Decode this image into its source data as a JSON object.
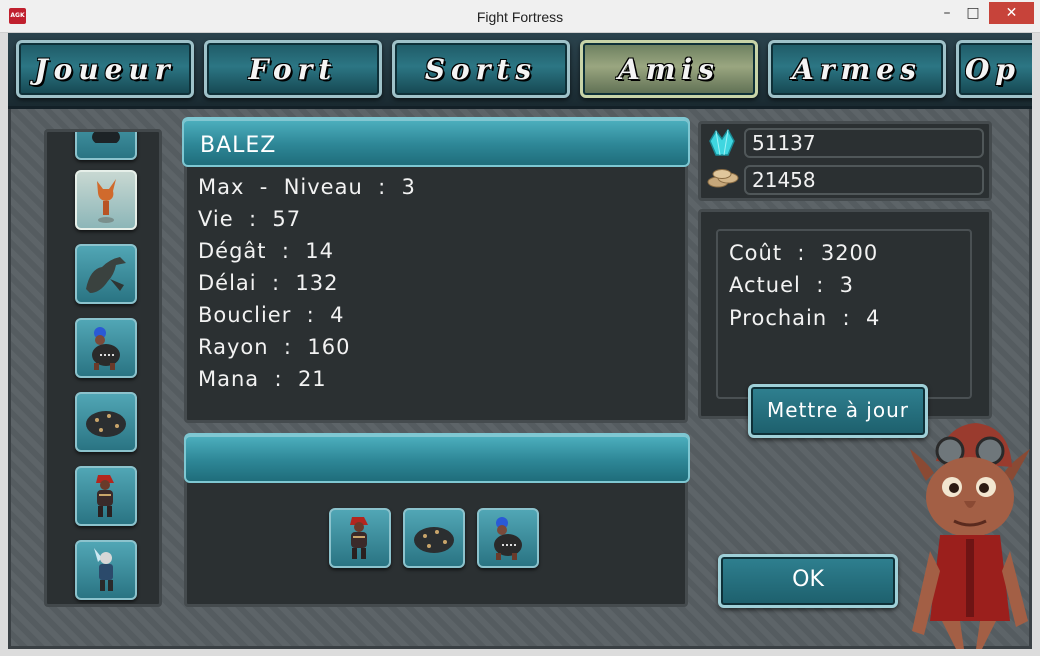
{
  "window": {
    "icon_text": "AGK",
    "title": "Fight Fortress",
    "minimize": "–",
    "maximize": "□",
    "close": "✕"
  },
  "tabs": [
    {
      "label": "Joueur",
      "active": false
    },
    {
      "label": "Fort",
      "active": false
    },
    {
      "label": "Sorts",
      "active": false
    },
    {
      "label": "Amis",
      "active": true
    },
    {
      "label": "Armes",
      "active": false
    },
    {
      "label": "Op",
      "active": false
    }
  ],
  "roster": {
    "items": [
      {
        "name": "unit-partial",
        "selected": false
      },
      {
        "name": "fire-imp",
        "selected": true
      },
      {
        "name": "sea-serpent",
        "selected": false
      },
      {
        "name": "blue-hair-warrior",
        "selected": false
      },
      {
        "name": "spiked-boulder",
        "selected": false
      },
      {
        "name": "red-hair-fighter",
        "selected": false
      },
      {
        "name": "winged-knight",
        "selected": false
      }
    ]
  },
  "unit": {
    "name": "BALEZ",
    "stats": [
      "Max  -  Niveau  :  3",
      "Vie  :  57",
      "Dégât  :  14",
      "Délai  :  132",
      "Bouclier  :  4",
      "Rayon  :  160",
      "Mana  :  21"
    ]
  },
  "team": {
    "title": "",
    "units": [
      "red-hair-fighter",
      "spiked-boulder",
      "blue-hair-warrior"
    ]
  },
  "resources": {
    "crystals": "51137",
    "coins": "21458"
  },
  "upgrade": {
    "cost": "Coût  :  3200",
    "current": "Actuel  :  3",
    "next": "Prochain  :  4",
    "button": "Mettre  à  jour"
  },
  "ok_button": "OK",
  "colors": {
    "accent_teal": "#2e8797",
    "active_tab": "#9aa680",
    "panel_bg": "#2b3032"
  }
}
